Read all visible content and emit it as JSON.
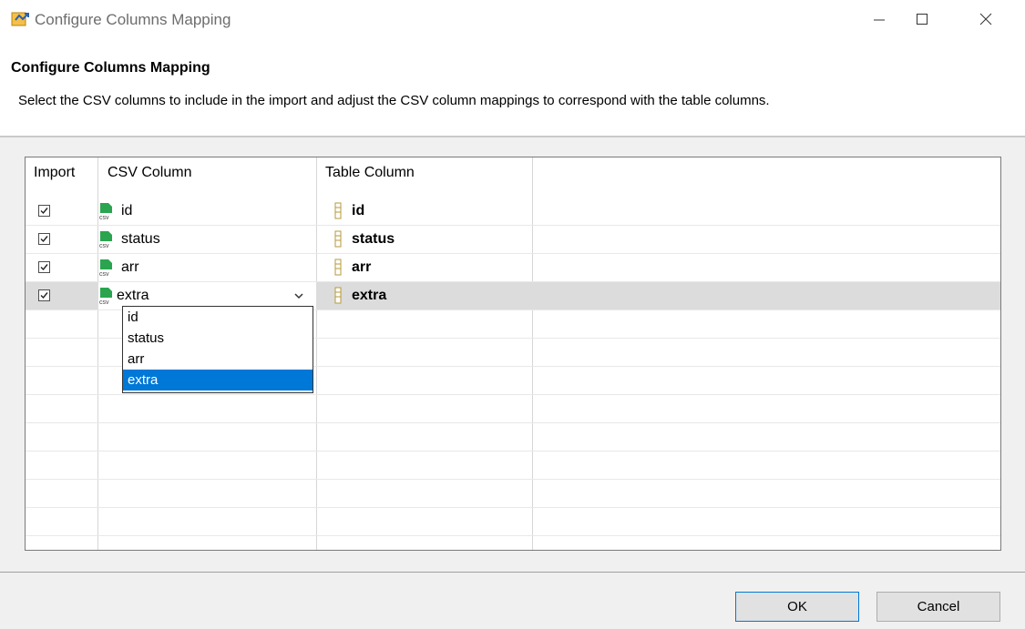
{
  "window": {
    "title": "Configure Columns Mapping",
    "icons": {
      "app": "import-wizard-icon",
      "minimize": "minimize-icon",
      "maximize": "maximize-icon",
      "close": "close-icon"
    }
  },
  "header": {
    "title": "Configure Columns Mapping",
    "description": "Select the CSV columns to include in the import and adjust the CSV column mappings to correspond with the table columns."
  },
  "table": {
    "headers": {
      "import": "Import",
      "csv_column": "CSV Column",
      "table_column": "Table Column"
    },
    "rows": [
      {
        "import": true,
        "csv_column": "id",
        "table_column": "id"
      },
      {
        "import": true,
        "csv_column": "status",
        "table_column": "status"
      },
      {
        "import": true,
        "csv_column": "arr",
        "table_column": "arr"
      },
      {
        "import": true,
        "csv_column": "extra",
        "table_column": "extra",
        "selected": true
      }
    ],
    "csv_icon_text": "csv"
  },
  "dropdown": {
    "options": [
      "id",
      "status",
      "arr",
      "extra"
    ],
    "selected": "extra"
  },
  "buttons": {
    "ok": "OK",
    "cancel": "Cancel"
  },
  "colors": {
    "accent": "#0078d7",
    "csv_icon": "#2aa44f",
    "column_icon": "#d4b24a"
  }
}
